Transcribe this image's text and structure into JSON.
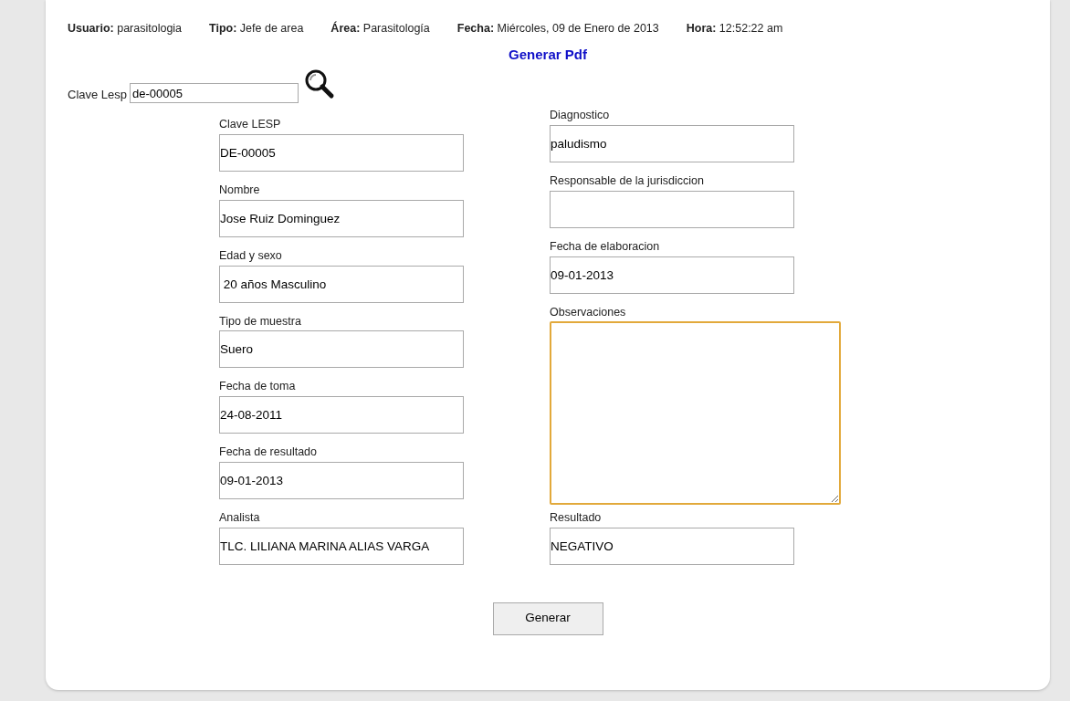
{
  "header": [
    {
      "text": "**Usuario:** parasitologia"
    },
    {
      "text": "**Tipo:** Jefe de area"
    },
    {
      "text": "**Área:** Parasitología"
    },
    {
      "text": "**Fecha:** Miércoles, 09 de Enero de 2013"
    },
    {
      "text": "**Hora:** 12:52:22 am"
    }
  ],
  "title": "Generar Pdf",
  "search": {
    "label": "Clave Lesp",
    "value": "de-00005"
  },
  "left_fields": [
    {
      "label": "Clave LESP",
      "value": "DE-00005"
    },
    {
      "label": "Nombre",
      "value": "Jose Ruiz Dominguez"
    },
    {
      "label": "Edad y sexo",
      "value": " 20 años Masculino"
    },
    {
      "label": "Tipo de muestra",
      "value": "Suero"
    },
    {
      "label": "Fecha de toma",
      "value": "24-08-2011"
    },
    {
      "label": "Fecha de resultado",
      "value": "09-01-2013"
    }
  ],
  "right_fields": [
    {
      "label": "Diagnostico",
      "value": "paludismo"
    },
    {
      "label": "Responsable de la jurisdiccion"
    },
    {
      "label": "Fecha de elaboracion",
      "value": "09-01-2013"
    }
  ],
  "observaciones": {
    "label": "Observaciones",
    "focused": true
  },
  "bottom_fields": [
    {
      "label": "Analista",
      "value": "TLC. LILIANA MARINA ALIAS VARGA"
    },
    {
      "label": "Resultado",
      "value": "NEGATIVO"
    }
  ],
  "button": "Generar"
}
